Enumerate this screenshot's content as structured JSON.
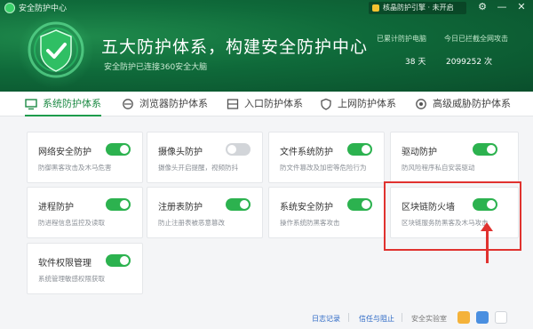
{
  "app": {
    "title": "安全防护中心",
    "engine_label": "核晶防护引擎 · 未开启"
  },
  "header": {
    "main_title": "五大防护体系，构建安全防护中心",
    "subtitle": "安全防护已连接360安全大脑",
    "stats": [
      {
        "label": "已累计防护电脑",
        "value": "38 天"
      },
      {
        "label": "今日已拦截全网攻击",
        "value": "2099252 次"
      }
    ]
  },
  "tabs": [
    {
      "label": "系统防护体系",
      "icon": "monitor-icon",
      "active": true
    },
    {
      "label": "浏览器防护体系",
      "icon": "browser-icon",
      "active": false
    },
    {
      "label": "入口防护体系",
      "icon": "entry-icon",
      "active": false
    },
    {
      "label": "上网防护体系",
      "icon": "shield-icon",
      "active": false
    },
    {
      "label": "高级威胁防护体系",
      "icon": "threat-icon",
      "active": false
    }
  ],
  "cards": [
    {
      "title": "网络安全防护",
      "desc": "防御黑客攻击及木马危害",
      "on": true
    },
    {
      "title": "摄像头防护",
      "desc": "摄像头开启提醒，视频防抖",
      "on": false
    },
    {
      "title": "文件系统防护",
      "desc": "防文件篡改及加密等危险行为",
      "on": true
    },
    {
      "title": "驱动防护",
      "desc": "防风险程序私自安装驱动",
      "on": true
    },
    {
      "title": "进程防护",
      "desc": "防进程信息监控及读取",
      "on": true
    },
    {
      "title": "注册表防护",
      "desc": "防止注册表被恶意篡改",
      "on": true
    },
    {
      "title": "系统安全防护",
      "desc": "操作系统防黑客攻击",
      "on": true
    },
    {
      "title": "区块链防火墙",
      "desc": "区块链服务防黑客及木马攻击",
      "on": true
    },
    {
      "title": "软件权限管理",
      "desc": "系统管理敏感权限获取",
      "on": true
    }
  ],
  "footer": {
    "log": "日志记录",
    "trust": "信任与阻止",
    "lab": "安全实验室"
  },
  "colors": {
    "accent": "#2cb24f",
    "header": "#0f6a3a",
    "highlight": "#e0322f"
  }
}
